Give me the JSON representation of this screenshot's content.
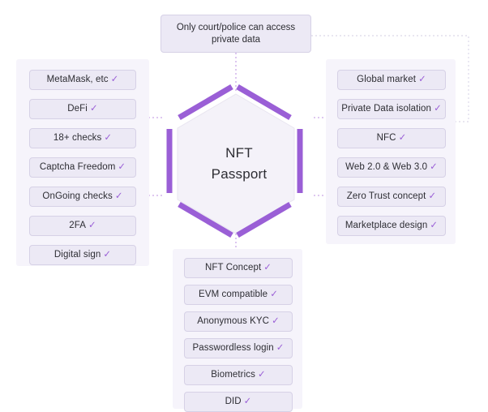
{
  "diagram": {
    "center": {
      "line1": "NFT",
      "line2": "Passport"
    },
    "top_callout": "Only court/police can access private data",
    "check_glyph": "✓"
  },
  "colors": {
    "hex_stroke": "#9a5fd6",
    "hex_fill": "#f4f2f9",
    "panel_bg": "#f6f4fb",
    "pill_bg": "#ece9f5",
    "pill_border": "#d6d1e6",
    "text": "#2d2d33",
    "connector": "#c9a8e8",
    "connector_faint": "#dcd8e8"
  },
  "left_panel": {
    "items": [
      {
        "label": "MetaMask, etc"
      },
      {
        "label": "DeFi"
      },
      {
        "label": "18+ checks"
      },
      {
        "label": "Captcha Freedom"
      },
      {
        "label": "OnGoing checks"
      },
      {
        "label": "2FA"
      },
      {
        "label": "Digital sign"
      }
    ]
  },
  "right_panel": {
    "items": [
      {
        "label": "Global market"
      },
      {
        "label": "Private Data isolation"
      },
      {
        "label": "NFC"
      },
      {
        "label": "Web 2.0 & Web 3.0"
      },
      {
        "label": "Zero Trust concept"
      },
      {
        "label": "Marketplace design"
      }
    ]
  },
  "bottom_panel": {
    "items": [
      {
        "label": "NFT Concept"
      },
      {
        "label": "EVM compatible"
      },
      {
        "label": "Anonymous KYC"
      },
      {
        "label": "Passwordless login"
      },
      {
        "label": "Biometrics"
      },
      {
        "label": "DID"
      }
    ]
  }
}
